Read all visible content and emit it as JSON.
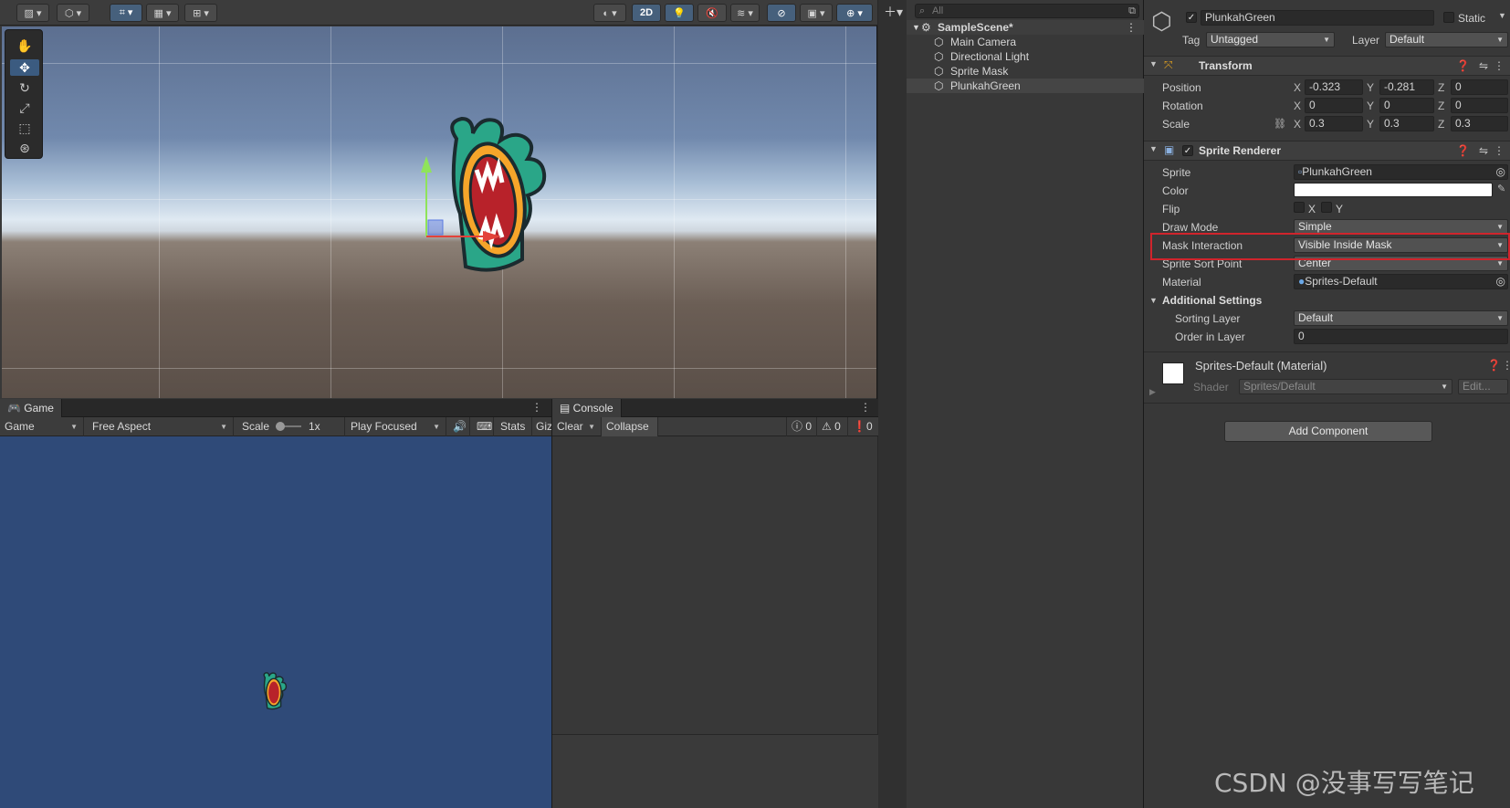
{
  "scene": {
    "toolbar": {
      "mode_2d": "2D"
    },
    "tools": [
      "hand-tool",
      "move-tool",
      "rotate-tool",
      "scale-tool",
      "rect-tool",
      "transform-tool"
    ]
  },
  "game": {
    "tab_label": "Game",
    "display": "Game",
    "aspect": "Free Aspect",
    "scale_label": "Scale",
    "scale_value": "1x",
    "play_mode": "Play Focused",
    "stats": "Stats",
    "gizmos": "Giz"
  },
  "console": {
    "tab_label": "Console",
    "clear": "Clear",
    "collapse": "Collapse",
    "log_count": "0",
    "warn_count": "0",
    "error_count": "0"
  },
  "hierarchy": {
    "search_placeholder": "All",
    "scene_name": "SampleScene*",
    "items": [
      "Main Camera",
      "Directional Light",
      "Sprite Mask",
      "PlunkahGreen"
    ]
  },
  "inspector": {
    "object_name": "PlunkahGreen",
    "static_label": "Static",
    "tag_label": "Tag",
    "tag_value": "Untagged",
    "layer_label": "Layer",
    "layer_value": "Default",
    "transform": {
      "title": "Transform",
      "position_label": "Position",
      "rotation_label": "Rotation",
      "scale_label": "Scale",
      "position": {
        "x": "-0.323",
        "y": "-0.281",
        "z": "0"
      },
      "rotation": {
        "x": "0",
        "y": "0",
        "z": "0"
      },
      "scale": {
        "x": "0.3",
        "y": "0.3",
        "z": "0.3"
      },
      "axis_x": "X",
      "axis_y": "Y",
      "axis_z": "Z"
    },
    "sprite_renderer": {
      "title": "Sprite Renderer",
      "sprite_label": "Sprite",
      "sprite_value": "PlunkahGreen",
      "color_label": "Color",
      "color_value": "#ffffff",
      "flip_label": "Flip",
      "flip_x": "X",
      "flip_y": "Y",
      "draw_mode_label": "Draw Mode",
      "draw_mode_value": "Simple",
      "mask_interaction_label": "Mask Interaction",
      "mask_interaction_value": "Visible Inside Mask",
      "sort_point_label": "Sprite Sort Point",
      "sort_point_value": "Center",
      "material_label": "Material",
      "material_value": "Sprites-Default",
      "additional_settings": "Additional Settings",
      "sorting_layer_label": "Sorting Layer",
      "sorting_layer_value": "Default",
      "order_label": "Order in Layer",
      "order_value": "0"
    },
    "material": {
      "title": "Sprites-Default (Material)",
      "shader_label": "Shader",
      "shader_value": "Sprites/Default",
      "edit": "Edit..."
    },
    "add_component": "Add Component"
  },
  "watermark": "CSDN @没事写写笔记",
  "colors": {
    "highlight": "#d0242c",
    "creature_green": "#2aa688",
    "mouth_red": "#b8222a"
  }
}
